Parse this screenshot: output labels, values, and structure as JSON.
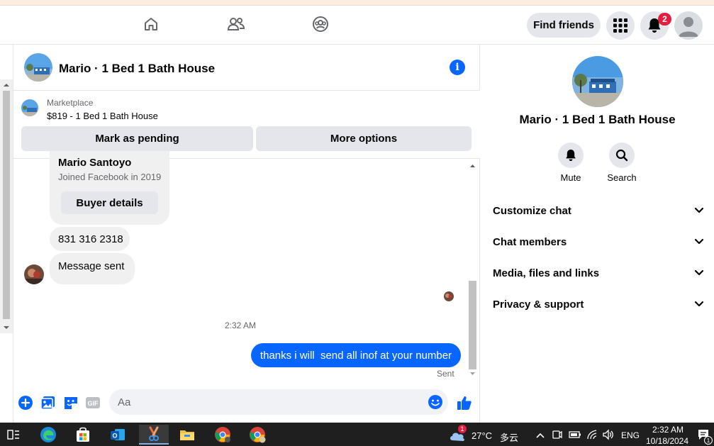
{
  "nav": {
    "find_friends": "Find friends",
    "notification_count": "2"
  },
  "chat": {
    "title": "Mario · 1 Bed 1 Bath House",
    "marketplace_label": "Marketplace",
    "listing": "$819 - 1 Bed 1 Bath House",
    "mark_pending": "Mark as pending",
    "more_options": "More options",
    "buyer_name": "Mario Santoyo",
    "buyer_joined": "Joined Facebook in 2019",
    "buyer_details": "Buyer details",
    "phone_message": "831 316 2318",
    "message_sent": "Message sent",
    "timestamp": "2:32 AM",
    "outgoing_message": "thanks i will  send all inof at your number",
    "status": "Sent",
    "composer_placeholder": "Aa"
  },
  "details": {
    "title": "Mario · 1 Bed 1 Bath House",
    "mute": "Mute",
    "search": "Search",
    "menu": [
      {
        "label": "Customize chat"
      },
      {
        "label": "Chat members"
      },
      {
        "label": "Media, files and links"
      },
      {
        "label": "Privacy & support"
      }
    ]
  },
  "taskbar": {
    "weather_badge": "1",
    "temperature": "27°C",
    "weather_text": "多云",
    "language": "ENG",
    "time": "2:32 AM",
    "date": "10/18/2024",
    "notification_badge": "1"
  },
  "colors": {
    "accent": "#0866ff",
    "badge": "#e41e3f",
    "button_gray": "#e4e6eb",
    "taskbar": "#1f1f1f"
  }
}
